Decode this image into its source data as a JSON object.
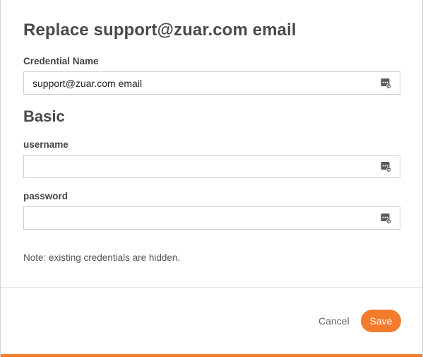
{
  "dialog": {
    "title": "Replace support@zuar.com email"
  },
  "credential_name": {
    "label": "Credential Name",
    "value": "support@zuar.com email",
    "placeholder": "",
    "icon": "password-key-icon"
  },
  "basic_section": {
    "heading": "Basic"
  },
  "username": {
    "label": "username",
    "value": "",
    "placeholder": "",
    "icon": "password-key-icon"
  },
  "password": {
    "label": "password",
    "value": "",
    "placeholder": "",
    "icon": "password-key-icon"
  },
  "note": "Note: existing credentials are hidden.",
  "footer": {
    "cancel_label": "Cancel",
    "save_label": "Save"
  },
  "colors": {
    "accent": "#f37b2c",
    "title_text": "#4a4a4a",
    "input_border": "#cfcfcf"
  }
}
